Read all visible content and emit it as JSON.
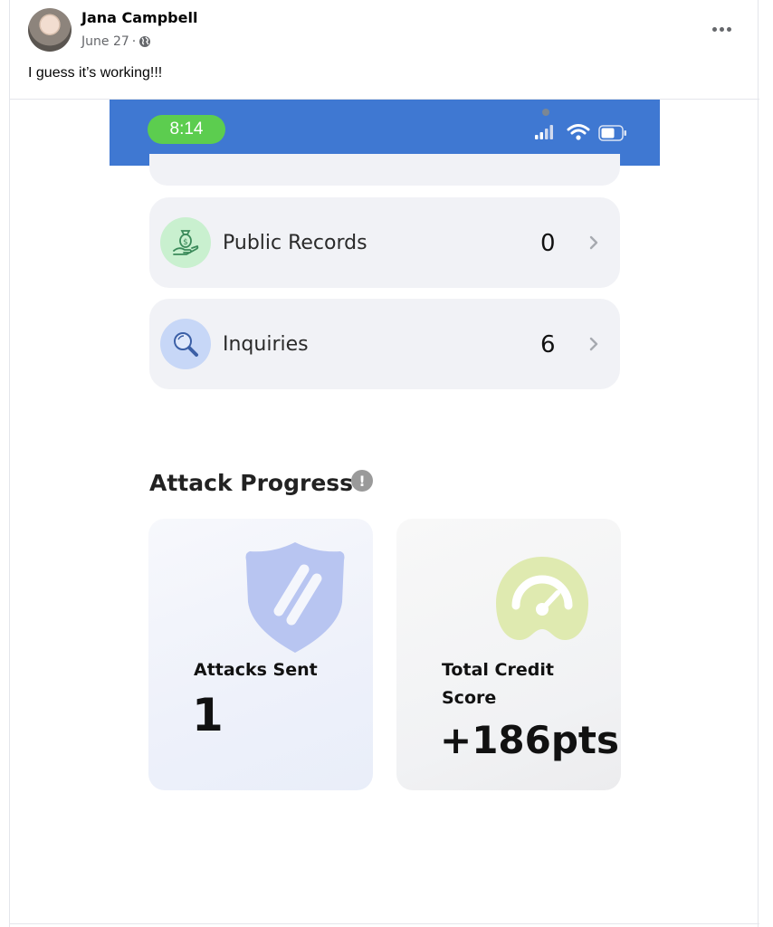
{
  "post": {
    "author": "Jana Campbell",
    "date": "June 27",
    "separator": "·",
    "text": "I guess it’s working!!!",
    "audience_icon": "globe-icon",
    "menu_icon": "more-icon"
  },
  "phone": {
    "time": "8:14",
    "status_bar_color": "#3f78d2",
    "rows": [
      {
        "label": "Public Records",
        "value": "0",
        "icon": "money-hand-icon"
      },
      {
        "label": "Inquiries",
        "value": "6",
        "icon": "magnifier-icon"
      }
    ],
    "section_title": "Attack Progress",
    "info_icon_glyph": "!",
    "cards": {
      "attacks": {
        "label": "Attacks Sent",
        "value": "1",
        "icon": "shield-icon"
      },
      "score": {
        "label_line1": "Total Credit",
        "label_line2": "Score",
        "value": "+186pts",
        "icon": "gauge-icon"
      }
    }
  },
  "colors": {
    "accent_green": "#5ccd4f",
    "card_bg": "#f1f2f6",
    "shield": "#b8c5f1",
    "gauge": "#dfeab0"
  }
}
